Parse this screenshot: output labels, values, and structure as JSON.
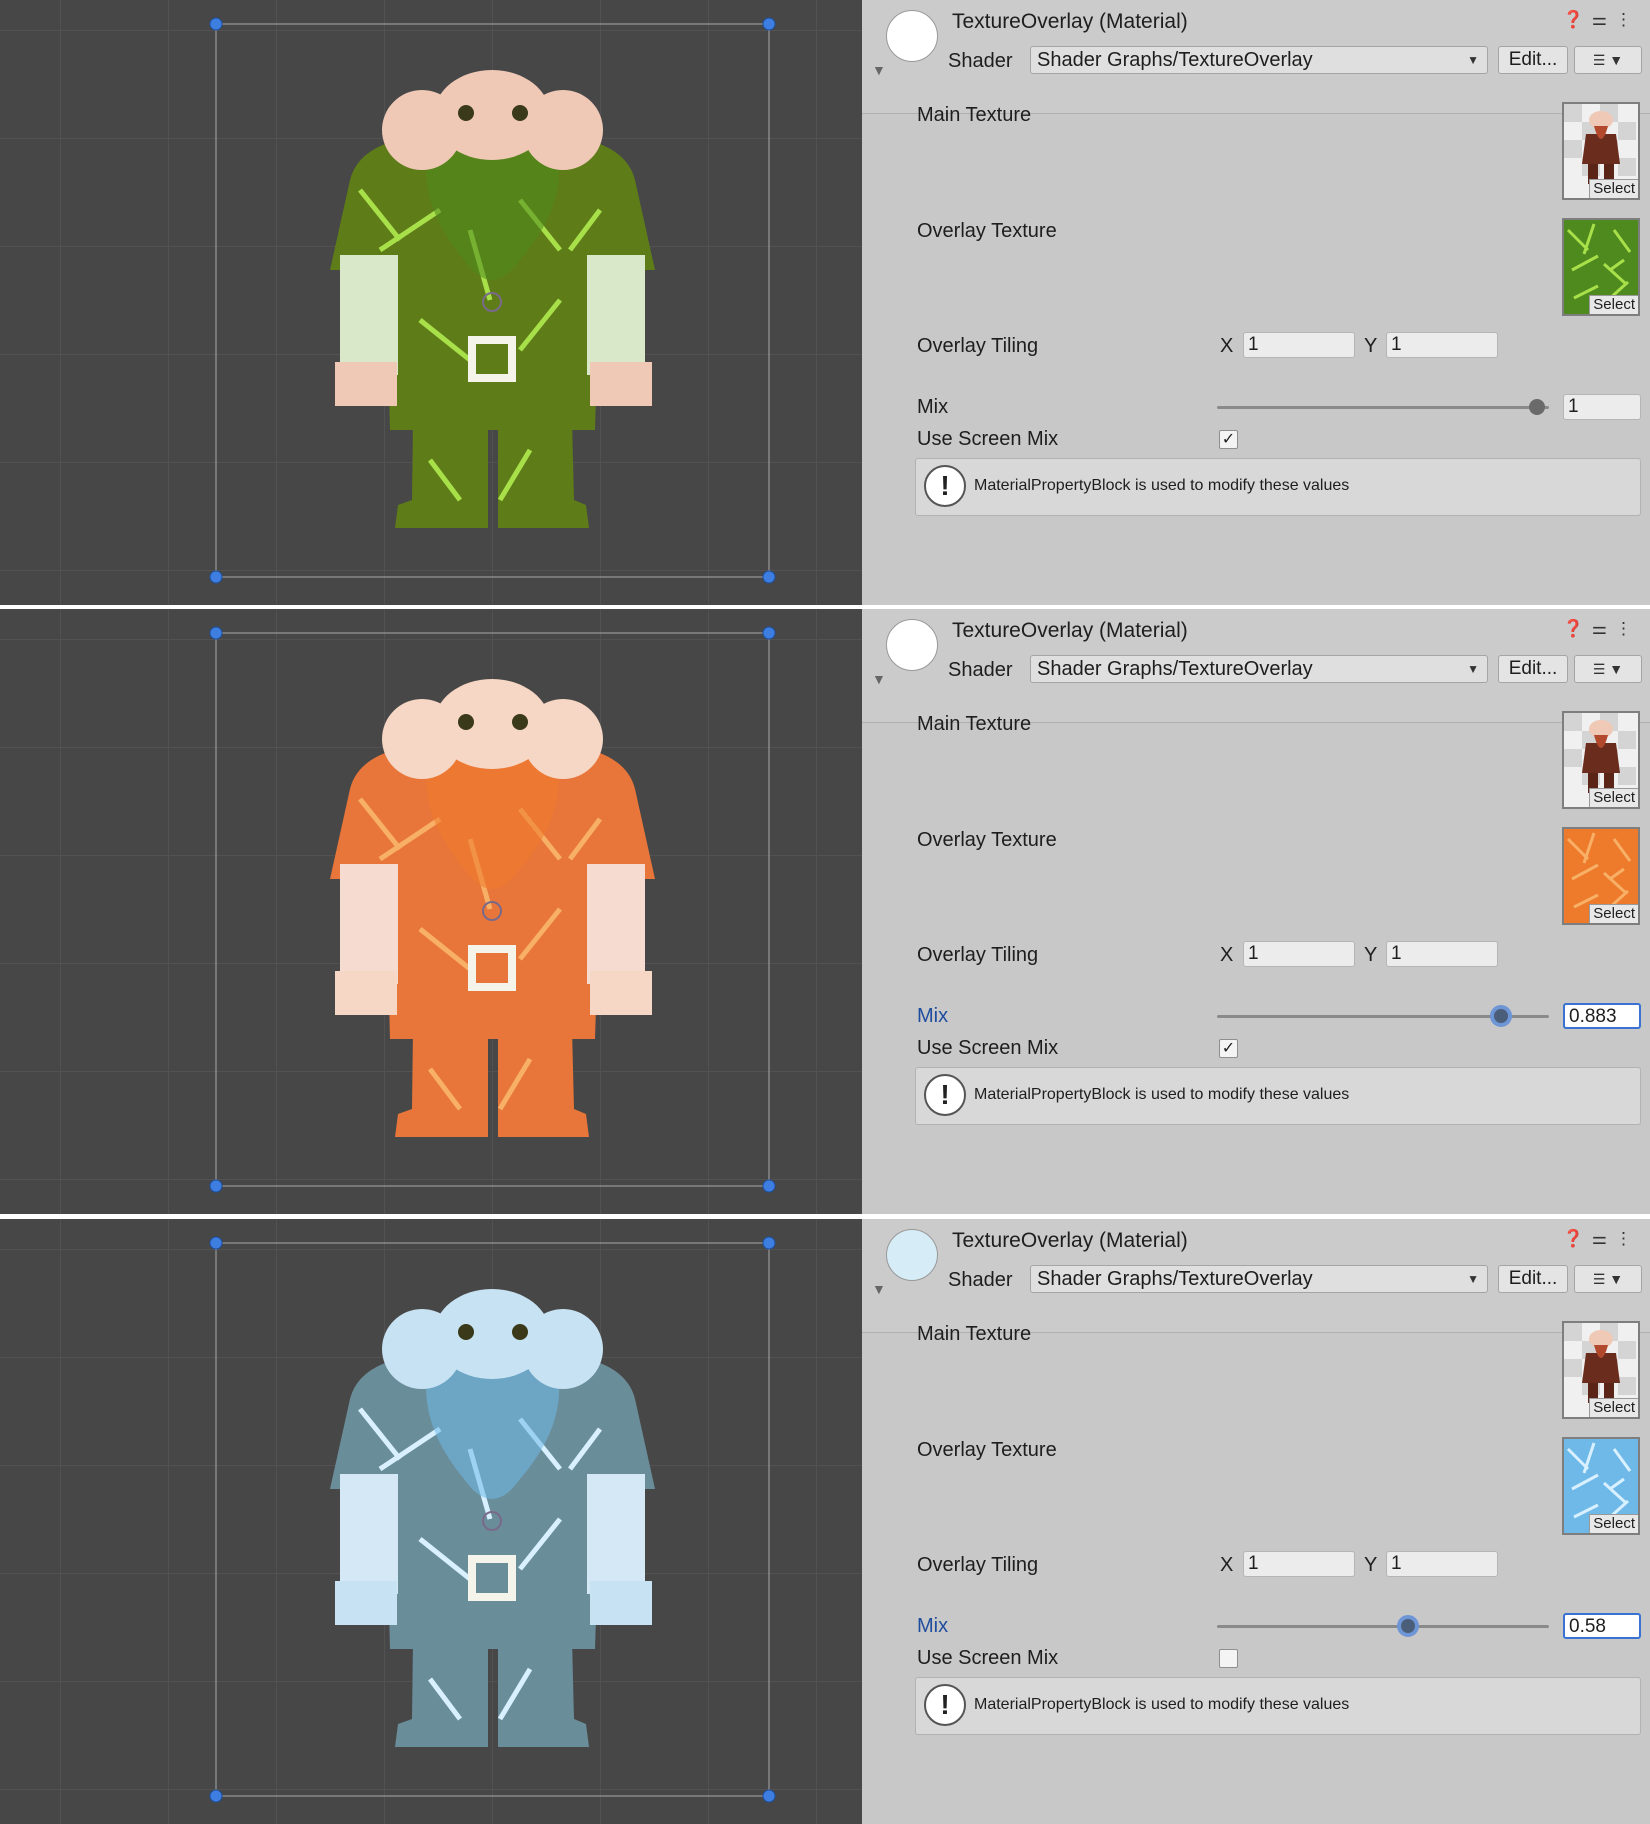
{
  "panels": [
    {
      "title": "TextureOverlay (Material)",
      "preview_color": "#ffffff",
      "shader_label": "Shader",
      "shader_value": "Shader Graphs/TextureOverlay",
      "edit_label": "Edit...",
      "main_texture_label": "Main Texture",
      "overlay_texture_label": "Overlay Texture",
      "tiling_label": "Overlay Tiling",
      "x_label": "X",
      "x_value": "1",
      "y_label": "Y",
      "y_value": "1",
      "mix_label": "Mix",
      "mix_value": "1",
      "mix_fraction": 1.0,
      "mix_active": false,
      "screen_mix_label": "Use Screen Mix",
      "screen_mix_checked": true,
      "select_label": "Select",
      "info_text": "MaterialPropertyBlock is used to modify these values",
      "overlay_color": "#4f8a1f",
      "overlay_accent": "#a8e04a",
      "body_base": "#5e7c18",
      "skin": "#efc9b6",
      "limb_overlay": "#d8e8c8"
    },
    {
      "title": "TextureOverlay (Material)",
      "preview_color": "#ffffff",
      "shader_label": "Shader",
      "shader_value": "Shader Graphs/TextureOverlay",
      "edit_label": "Edit...",
      "main_texture_label": "Main Texture",
      "overlay_texture_label": "Overlay Texture",
      "tiling_label": "Overlay Tiling",
      "x_label": "X",
      "x_value": "1",
      "y_label": "Y",
      "y_value": "1",
      "mix_label": "Mix",
      "mix_value": "0.883",
      "mix_fraction": 0.883,
      "mix_active": true,
      "screen_mix_label": "Use Screen Mix",
      "screen_mix_checked": true,
      "select_label": "Select",
      "info_text": "MaterialPropertyBlock is used to modify these values",
      "overlay_color": "#ee7a2c",
      "overlay_accent": "#f7b066",
      "body_base": "#e8763a",
      "skin": "#f6d6c4",
      "limb_overlay": "#f6dcd0"
    },
    {
      "title": "TextureOverlay (Material)",
      "preview_color": "#d6ecf6",
      "shader_label": "Shader",
      "shader_value": "Shader Graphs/TextureOverlay",
      "edit_label": "Edit...",
      "main_texture_label": "Main Texture",
      "overlay_texture_label": "Overlay Texture",
      "tiling_label": "Overlay Tiling",
      "x_label": "X",
      "x_value": "1",
      "y_label": "Y",
      "y_value": "1",
      "mix_label": "Mix",
      "mix_value": "0.58",
      "mix_fraction": 0.58,
      "mix_active": true,
      "screen_mix_label": "Use Screen Mix",
      "screen_mix_checked": false,
      "select_label": "Select",
      "info_text": "MaterialPropertyBlock is used to modify these values",
      "overlay_color": "#6fb9e8",
      "overlay_accent": "#d8f0ff",
      "body_base": "#6a8d9a",
      "skin": "#c7e2f2",
      "limb_overlay": "#d4e8f6"
    }
  ]
}
